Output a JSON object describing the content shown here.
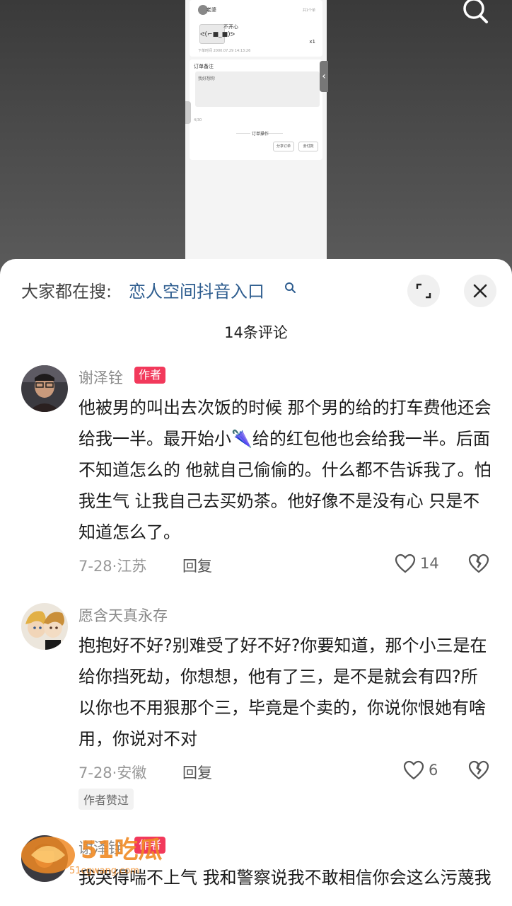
{
  "video": {
    "search_icon": "search-icon",
    "phone": {
      "contact_name": "老婆",
      "order_count": "共1个单",
      "product_title": "不开心",
      "product_thumb": "ᕙ(⌐■_■)ᕗ",
      "quantity": "x1",
      "order_time": "下单时间 2000.07.29 14:13:26",
      "note_title": "订单备注",
      "note_text": "我好想你",
      "note_count": "4/30",
      "actions_title": "订单操作",
      "btn_share": "分享订单",
      "btn_more": "去付款"
    }
  },
  "sheet": {
    "search_prefix": "大家都在搜:",
    "search_term": "恋人空间抖音入口",
    "comment_count": "14条评论"
  },
  "comments": [
    {
      "username": "谢泽铨",
      "tag": "作者",
      "text": "他被男的叫出去次饭的时候 那个男的给的打车费他还会给我一半。最开始小🌂给的红包他也会给我一半。后面不知道怎么的 他就自己偷偷的。什么都不告诉我了。怕我生气 让我自己去买奶茶。他好像不是没有心 只是不知道怎么了。",
      "date_loc": "7-28·江苏",
      "reply": "回复",
      "likes": "14"
    },
    {
      "username": "愿含天真永存",
      "text": "抱抱好不好?别难受了好不好?你要知道，那个小三是在给你挡死劫，你想想，他有了三，是不是就会有四?所以你也不用狠那个三，毕竟是个卖的，你说你恨她有啥用，你说对不对",
      "date_loc": "7-28·安徽",
      "reply": "回复",
      "likes": "6",
      "badge": "作者赞过"
    },
    {
      "username": "谢泽铨",
      "tag": "作者",
      "text": "我哭得喘不上气 我和警察说我不敢相信你会这么污蔑我"
    }
  ],
  "watermark": {
    "logo_text": "51吃瓜",
    "url_text": "51cgwang.com"
  },
  "colors": {
    "author_tag": "#f2395b",
    "search_term": "#2e5d8f",
    "meta_text": "#999999"
  }
}
